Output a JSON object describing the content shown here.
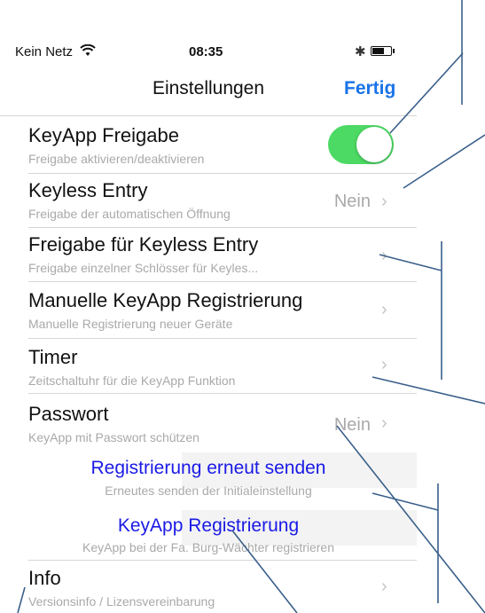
{
  "status_bar": {
    "carrier": "Kein Netz",
    "time": "08:35",
    "wifi_icon": "wifi-icon",
    "bluetooth_icon": "bluetooth-icon",
    "battery_level": 0.7
  },
  "navbar": {
    "title": "Einstellungen",
    "done_label": "Fertig"
  },
  "colors": {
    "accent_blue": "#1a73e8",
    "toggle_green": "#4cd964",
    "center_text_blue": "#1a1ae6",
    "annotation_line": "#3a5f8a"
  },
  "rows": [
    {
      "title": "KeyApp Freigabe",
      "subtitle": "Freigabe aktivieren/deaktivieren",
      "toggle_on": true
    },
    {
      "title": "Keyless Entry",
      "subtitle": "Freigabe der automatischen Öffnung",
      "detail": "Nein"
    },
    {
      "title": "Freigabe für Keyless Entry",
      "subtitle": "Freigabe einzelner Schlösser für Keyles..."
    },
    {
      "title": "Manuelle KeyApp Registrierung",
      "subtitle": "Manuelle Registrierung neuer Geräte"
    },
    {
      "title": "Timer",
      "subtitle": "Zeitschaltuhr für die KeyApp Funktion"
    },
    {
      "title": "Passwort",
      "subtitle": "KeyApp mit Passwort schützen",
      "detail": "Nein"
    },
    {
      "title": "Registrierung erneut senden",
      "subtitle": "Erneutes senden der Initialeinstellung"
    },
    {
      "title": "KeyApp Registrierung",
      "subtitle": "KeyApp bei der Fa. Burg-Wächter registrieren"
    },
    {
      "title": "Info",
      "subtitle": "Versionsinfo / Lizensvereinbarung"
    }
  ]
}
